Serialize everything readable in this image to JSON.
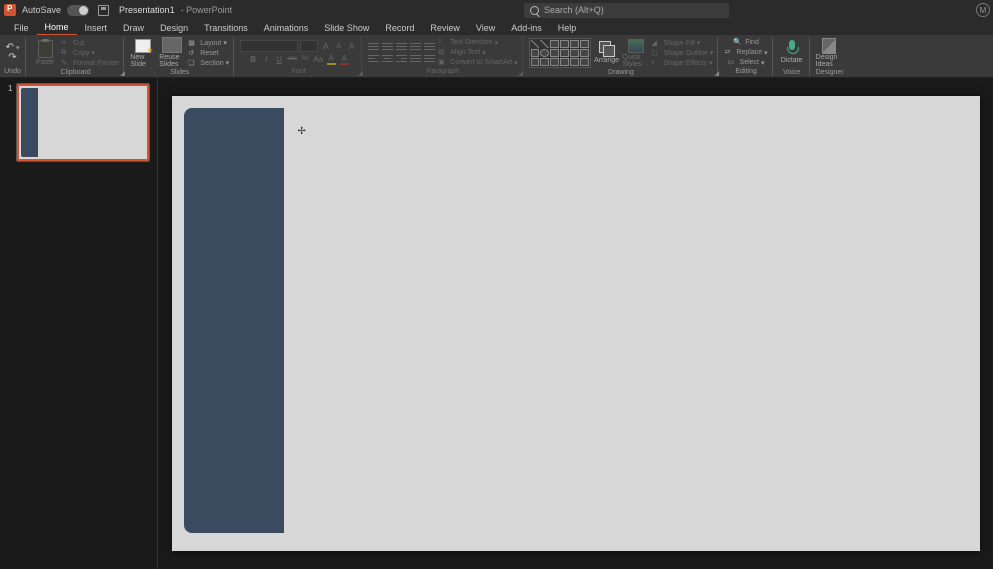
{
  "titlebar": {
    "autosave": "AutoSave",
    "toggle_state": "Off",
    "doc": "Presentation1",
    "app": "PowerPoint",
    "search_placeholder": "Search (Alt+Q)",
    "user_initial": "M"
  },
  "tabs": {
    "file": "File",
    "home": "Home",
    "insert": "Insert",
    "draw": "Draw",
    "design": "Design",
    "transitions": "Transitions",
    "animations": "Animations",
    "slideshow": "Slide Show",
    "record": "Record",
    "review": "Review",
    "view": "View",
    "addins": "Add-ins",
    "help": "Help"
  },
  "ribbon": {
    "undo_grp": "Undo",
    "clipboard": {
      "paste": "Paste",
      "cut": "Cut",
      "copy": "Copy",
      "fmt": "Format Painter",
      "grp": "Clipboard"
    },
    "slides": {
      "new": "New Slide",
      "reuse": "Reuse Slides",
      "layout": "Layout",
      "reset": "Reset",
      "section": "Section",
      "grp": "Slides"
    },
    "font": {
      "grp": "Font",
      "grow": "A",
      "shrink": "A",
      "clear": "A",
      "bold": "B",
      "italic": "I",
      "under": "U",
      "strike": "abc",
      "spacing": "AV",
      "case": "Aa",
      "highlight": "A",
      "color": "A"
    },
    "para": {
      "grp": "Paragraph",
      "dir": "Text Direction",
      "align": "Align Text",
      "smart": "Convert to SmartArt"
    },
    "drawing": {
      "grp": "Drawing",
      "arrange": "Arrange",
      "styles": "Quick Styles",
      "fill": "Shape Fill",
      "outline": "Shape Outline",
      "effects": "Shape Effects"
    },
    "editing": {
      "find": "Find",
      "replace": "Replace",
      "select": "Select",
      "grp": "Editing"
    },
    "voice": {
      "dictate": "Dictate",
      "grp": "Voice"
    },
    "designer": {
      "ideas": "Design Ideas",
      "grp": "Designer"
    }
  },
  "thumbs": {
    "n1": "1"
  },
  "colors": {
    "accent": "#d35230",
    "slide_blue": "#3a4a5f"
  }
}
